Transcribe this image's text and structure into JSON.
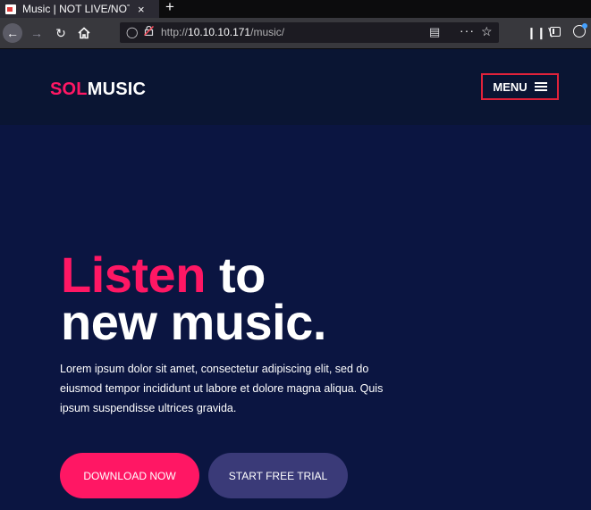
{
  "browser": {
    "tab_title": "Music | NOT LIVE/NOT F",
    "tab_close": "×",
    "newtab": "+",
    "url_prefix": "http://",
    "url_host": "10.10.10.171",
    "url_path": "/music/",
    "icons": [
      "back-icon",
      "forward-icon",
      "reload-icon",
      "home-icon",
      "shield-icon",
      "insecure-lock-icon",
      "reader-icon",
      "more-icon",
      "star-icon",
      "library-icon",
      "sidebar-icon",
      "account-icon"
    ]
  },
  "header": {
    "logo_accent": "SOL",
    "logo_rest": "MUSIC",
    "menu_label": "MENU"
  },
  "hero": {
    "title_accent": "Listen",
    "title_rest": " to",
    "title_line2": "new music.",
    "lead": "Lorem ipsum dolor sit amet, consectetur adipiscing elit, sed do eiusmod tempor incididunt ut labore et dolore magna aliqua. Quis ipsum suspendisse ultrices gravida.",
    "primary_button": "DOWNLOAD NOW",
    "secondary_button": "START FREE TRIAL"
  },
  "colors": {
    "accent": "#ff1764",
    "background": "#0b1541",
    "header_bg": "#0a1533",
    "secondary_button": "#3a3a78",
    "menu_border": "#e0223a"
  }
}
